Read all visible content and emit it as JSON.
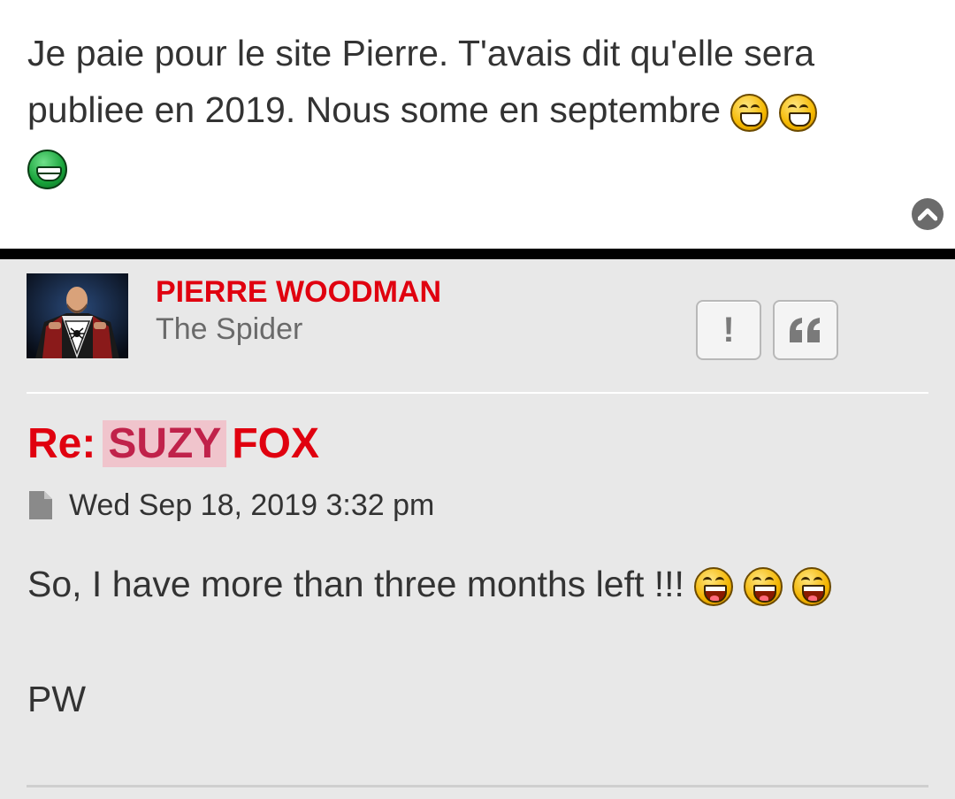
{
  "previous_post": {
    "text": "Je paie pour le site Pierre. T'avais dit qu'elle sera publiee en 2019. Nous some en septembre",
    "emoji": [
      "grin-smiley",
      "grin-smiley",
      "green-grin-smiley"
    ]
  },
  "back_to_top": {
    "icon": "chevron-up-icon"
  },
  "post": {
    "author": {
      "name": "PIERRE WOODMAN",
      "rank": "The Spider"
    },
    "buttons": {
      "report": "!",
      "quote": "“"
    },
    "title": {
      "prefix": "Re:",
      "highlight": "SUZY",
      "suffix": "FOX"
    },
    "date": "Wed Sep 18, 2019 3:32 pm",
    "body": {
      "line": "So, I have more than three months left !!!",
      "emoji": [
        "laughing-smiley",
        "laughing-smiley",
        "laughing-smiley"
      ],
      "signature": "PW"
    }
  },
  "colors": {
    "author": "#e0000f",
    "title": "#e0000f",
    "highlight_bg": "#f0c4cc",
    "post_bg": "#e8e8e8",
    "separator": "#000000"
  }
}
